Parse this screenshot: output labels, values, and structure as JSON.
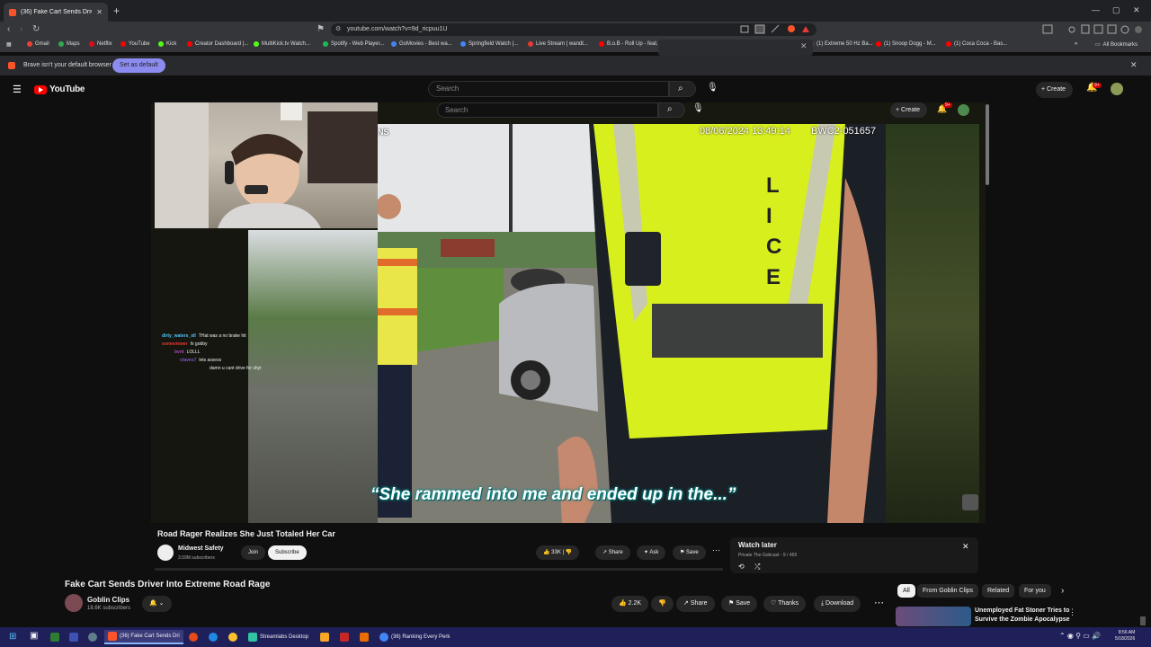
{
  "browser": {
    "tab_title": "(36) Fake Cart Sends Driver In",
    "url": "youtube.com/watch?v=9d_ricpuu1U",
    "bookmarks": [
      {
        "label": "Gmail",
        "color": "#ea4335"
      },
      {
        "label": "Maps",
        "color": "#34a853"
      },
      {
        "label": "Netflix",
        "color": "#e50914"
      },
      {
        "label": "YouTube",
        "color": "#ff0000"
      },
      {
        "label": "Kick",
        "color": "#53fc18"
      },
      {
        "label": "Creator Dashboard |...",
        "color": "#ff0000"
      },
      {
        "label": "MultiKick.tv Watch...",
        "color": "#53fc18"
      },
      {
        "label": "Spotify - Web Player...",
        "color": "#1db954"
      },
      {
        "label": "GoMovies - Best wa...",
        "color": "#4285f4"
      },
      {
        "label": "Springfield Watch |...",
        "color": "#4285f4"
      },
      {
        "label": "Live Stream | wandt...",
        "color": "#e53935"
      },
      {
        "label": "B.o.B - Roll Up - feat...",
        "color": "#ff0000"
      },
      {
        "label": "(1) Extreme 50 Hz Ba...",
        "color": "#ff0000"
      },
      {
        "label": "(1) Snoop Dogg - M...",
        "color": "#ff0000"
      },
      {
        "label": "(1) Coca Coca - Bas...",
        "color": "#ff0000"
      }
    ],
    "all_bookmarks": "All Bookmarks",
    "infobar_text": "Brave isn't your default browser",
    "infobar_button": "Set as default"
  },
  "youtube": {
    "logo_text": "YouTube",
    "search_placeholder": "Search",
    "create_label": "Create",
    "notif_count": "9+",
    "inner": {
      "search_placeholder": "Search",
      "create_label": "Create",
      "notif_count": "9+"
    }
  },
  "video": {
    "timestamp": "08/06/2024 13:49:14",
    "cam_id": "BWC2-051657",
    "edge_text": "NS",
    "vest_letters": [
      "L",
      "I",
      "C",
      "E"
    ],
    "caption": "“She rammed into me and ended up in the...”",
    "chat": [
      {
        "user": "dirty_waters_xII",
        "color": "#4fc3f7",
        "msg": "THat was a no brake hit"
      },
      {
        "user": "someviewer",
        "color": "#e53935",
        "msg": "hi gobby"
      },
      {
        "user": "bvnt",
        "color": "#ab47bc",
        "msg": "LOLLL"
      },
      {
        "user": "ctaves7",
        "color": "#7e57c2",
        "msg": "lets assess"
      },
      {
        "user": "",
        "color": "#fff",
        "msg": "damn u cant drive for shyt"
      }
    ]
  },
  "inner_video": {
    "title": "Road Rager Realizes She Just Totaled Her Car",
    "channel": "Midwest Safety",
    "subscribers": "3.59M subscribers",
    "join": "Join",
    "subscribe": "Subscribe",
    "likes": "33K",
    "share": "Share",
    "ask": "Ask",
    "save": "Save"
  },
  "watch_later": {
    "title": "Watch later",
    "subtitle": "Private  The Gobcast - 9 / 465"
  },
  "outer_video": {
    "title": "Fake Cart Sends Driver Into Extreme Road Rage",
    "channel": "Goblin Clips",
    "subscribers": "18.6K subscribers",
    "likes": "2.2K",
    "share": "Share",
    "save": "Save",
    "thanks": "Thanks",
    "download": "Download"
  },
  "chips": [
    "All",
    "From Goblin Clips",
    "Related",
    "For you"
  ],
  "recommended": {
    "title_line1": "Unemployed Fat Stoner Tries to",
    "title_line2": "Survive the Zombie Apocalypse"
  },
  "taskbar": {
    "apps": [
      {
        "label": "(36) Fake Cart Sends Dri",
        "color": "#fb542b",
        "active": true
      },
      {
        "label": "Streamlabs Desktop",
        "color": "#31c3a2",
        "active": false
      },
      {
        "label": "(36) Ranking Every Perk",
        "color": "#4285f4",
        "active": false
      }
    ],
    "time": "8:56 AM",
    "date": "5/18/2026"
  }
}
